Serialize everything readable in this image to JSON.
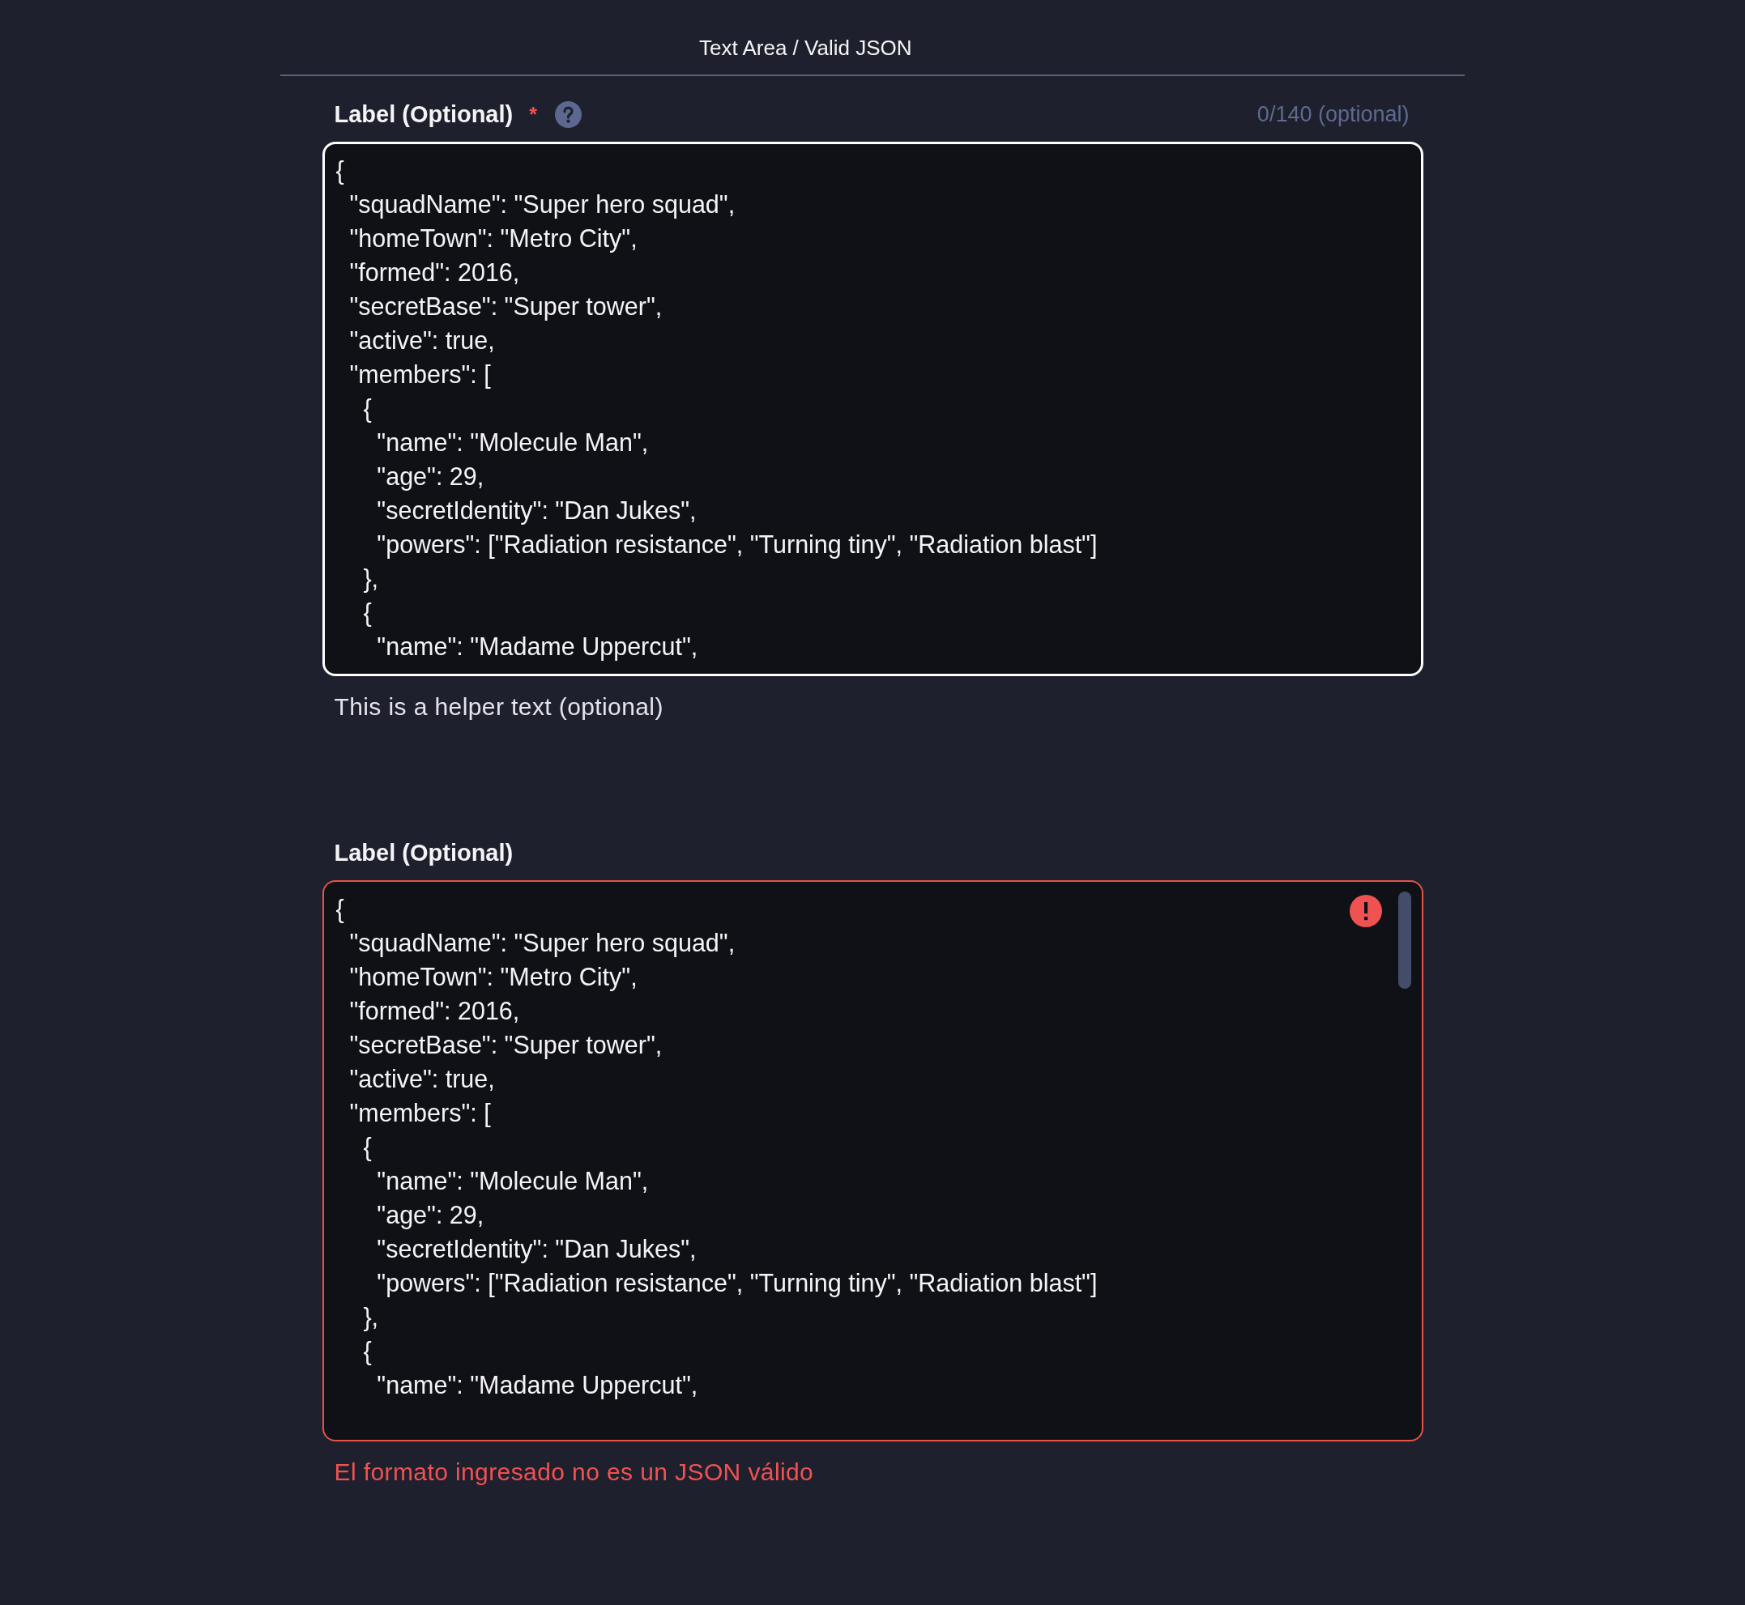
{
  "header": {
    "title": "Text Area / Valid JSON"
  },
  "fields": [
    {
      "label": "Label (Optional)",
      "required_marker": "*",
      "help_icon": true,
      "counter": "0/140 (optional)",
      "focused": true,
      "error": false,
      "value": "{\n  \"squadName\": \"Super hero squad\",\n  \"homeTown\": \"Metro City\",\n  \"formed\": 2016,\n  \"secretBase\": \"Super tower\",\n  \"active\": true,\n  \"members\": [\n    {\n      \"name\": \"Molecule Man\",\n      \"age\": 29,\n      \"secretIdentity\": \"Dan Jukes\",\n      \"powers\": [\"Radiation resistance\", \"Turning tiny\", \"Radiation blast\"]\n    },\n    {\n      \"name\": \"Madame Uppercut\",",
      "message": "This is a helper text (optional)"
    },
    {
      "label": "Label (Optional)",
      "error": true,
      "scrollbar": true,
      "value": "{\n  \"squadName\": \"Super hero squad\",\n  \"homeTown\": \"Metro City\",\n  \"formed\": 2016,\n  \"secretBase\": \"Super tower\",\n  \"active\": true,\n  \"members\": [\n    {\n      \"name\": \"Molecule Man\",\n      \"age\": 29,\n      \"secretIdentity\": \"Dan Jukes\",\n      \"powers\": [\"Radiation resistance\", \"Turning tiny\", \"Radiation blast\"]\n    },\n    {\n      \"name\": \"Madame Uppercut\",",
      "message": "El formato ingresado no es un JSON válido"
    }
  ]
}
